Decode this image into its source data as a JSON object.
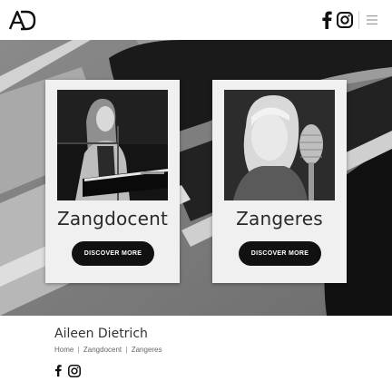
{
  "header": {
    "logo_text": "AD",
    "icons": [
      "facebook-icon",
      "instagram-icon",
      "hamburger-menu-icon"
    ]
  },
  "cards": [
    {
      "title": "Zangdocent",
      "button_label": "DISCOVER MORE",
      "photo": "singer-at-keyboard-photo"
    },
    {
      "title": "Zangeres",
      "button_label": "DISCOVER MORE",
      "photo": "singer-with-microphone-photo"
    }
  ],
  "footer": {
    "name": "Aileen Dietrich",
    "nav": [
      "Home",
      "Zangdocent",
      "Zangeres"
    ],
    "nav_separator": "|",
    "icons": [
      "facebook-icon",
      "instagram-icon"
    ]
  },
  "colors": {
    "button_bg": "#111111",
    "card_bg": "#f0f0f0",
    "hero_tone": "grayscale"
  }
}
